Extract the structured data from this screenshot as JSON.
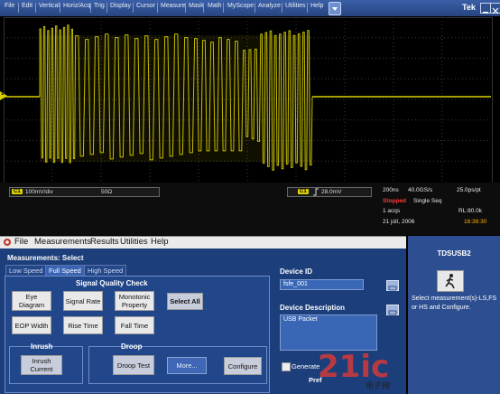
{
  "scope": {
    "menu": [
      "File",
      "Edit",
      "Vertical",
      "Horiz/Acq",
      "Trig",
      "Display",
      "Cursor",
      "Measure",
      "Mask",
      "Math",
      "MyScope",
      "Analyze",
      "Utilities",
      "Help"
    ],
    "brand": "Tek",
    "ch1_scale": "100mV/div",
    "ch1_impedance": "50Ω",
    "ch1_badge": "C1",
    "trigger_level": "28.0mV",
    "trigger_badge": "C1",
    "trigger_slope_icon": "rising-edge-icon",
    "horiz_scale": "200ns",
    "sample_rate": "40.0GS/s",
    "resolution": "25.0ps/pt",
    "run_state": "Stopped",
    "acq_mode": "Single Seq",
    "acqs": "1 acqs",
    "record_length": "RL:80.0k",
    "date": "21 júlí, 2006",
    "time": "16:38:30",
    "ch1_marker": "1",
    "trace_color": "#d9d100",
    "stopped_color": "#ff3b3b"
  },
  "app": {
    "menu": [
      "File",
      "Measurements",
      "Results",
      "Utilities",
      "Help"
    ],
    "menu_icon": "app-logo-icon",
    "title": "Measurements: Select",
    "speed_tabs": [
      "Low Speed",
      "Full Speed",
      "High Speed"
    ],
    "signal_quality_title": "Signal Quality Check",
    "buttons": {
      "eye": "Eye Diagram",
      "signal_rate": "Signal Rate",
      "monotonic": "Monotonic Property",
      "select_all": "Select All",
      "eop": "EOP Width",
      "rise": "Rise Time",
      "fall": "Fall Time",
      "inrush_title": "Inrush",
      "inrush": "Inrush Current",
      "droop_title": "Droop",
      "droop": "Droop Test",
      "more": "More...",
      "configure": "Configure"
    },
    "device_id_label": "Device ID",
    "device_id_value": "fsfe_001",
    "device_desc_label": "Device Description",
    "device_desc_value": "USB Packet",
    "generate_label": "Generate",
    "pref_label": "Pref",
    "side_title": "TDSUSB2",
    "side_help": "Select measurement(s)-LS,FS or HS and Configure.",
    "run_icon": "running-man-icon"
  },
  "watermark": {
    "main": "21ic",
    "sub": "电子网"
  }
}
